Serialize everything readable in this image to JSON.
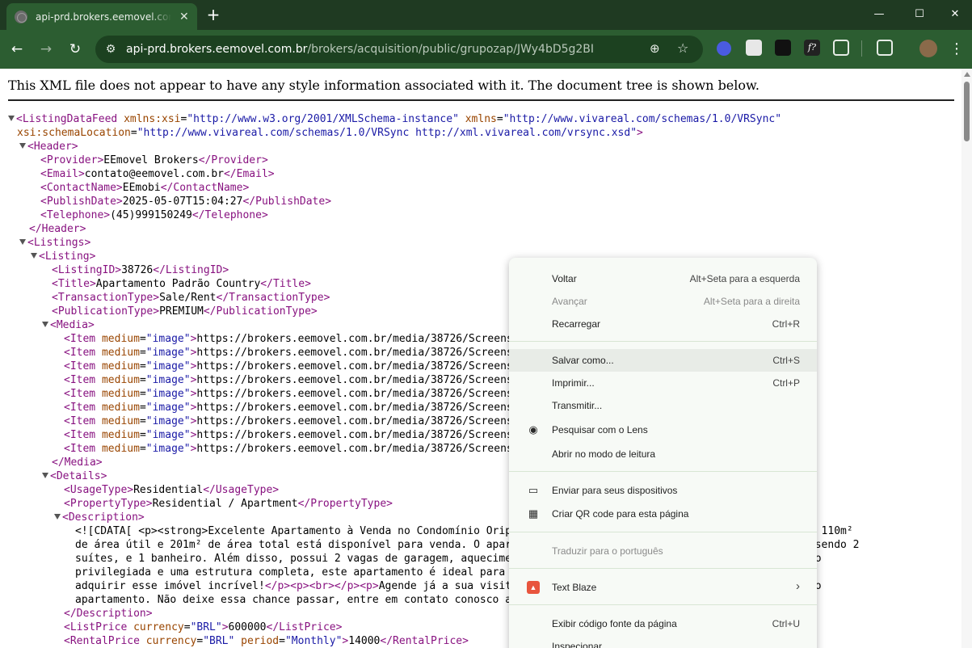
{
  "browser": {
    "tab_title": "api-prd.brokers.eemovel.com.br/brokers/acquisition/public/grupozap/JWy4bD5g2BI",
    "tab_close": "✕",
    "new_tab": "+",
    "window_minimize": "—",
    "window_maximize": "☐",
    "window_close": "✕",
    "url_host": "api-prd.brokers.eemovel.com.br",
    "url_path": "/brokers/acquisition/public/grupozap/JWy4bD5g2BI",
    "back": "←",
    "forward": "→",
    "reload": "↻",
    "site_info": "⚙",
    "zoom": "⊕",
    "bookmark": "☆",
    "menu": "⋮",
    "extension_f_label": "f?",
    "colors": {
      "tabbar": "#1f3a22",
      "toolbar": "#2c5d31",
      "omnibox": "#1c4120"
    }
  },
  "page": {
    "banner": "This XML file does not appear to have any style information associated with it. The document tree is shown below.",
    "xml_lines": [
      "<ListingDataFeed xmlns:xsi=\"http://www.w3.org/2001/XMLSchema-instance\" xmlns=\"http://www.vivareal.com/schemas/1.0/VRSync\"",
      "xsi:schemaLocation=\"http://www.vivareal.com/schemas/1.0/VRSync http://xml.vivareal.com/vrsync.xsd\">",
      "<Header>",
      "<Provider>EEmovel Brokers</Provider>",
      "<Email>contato@eemovel.com.br</Email>",
      "<ContactName>EEmobi</ContactName>",
      "<PublishDate>2025-05-07T15:04:27</PublishDate>",
      "<Telephone>(45)999150249</Telephone>",
      "</Header>",
      "<Listings>",
      "<Listing>",
      "<ListingID>38726</ListingID>",
      "<Title>Apartamento Padrão Country</Title>",
      "<TransactionType>Sale/Rent</TransactionType>",
      "<PublicationType>PREMIUM</PublicationType>",
      "<Media>",
      "<Item medium=\"image\">https://brokers.eemovel.com.br/media/38726/Screens",
      "<Item medium=\"image\">https://brokers.eemovel.com.br/media/38726/Screens",
      "<Item medium=\"image\">https://brokers.eemovel.com.br/media/38726/Screens",
      "<Item medium=\"image\">https://brokers.eemovel.com.br/media/38726/Screens",
      "<Item medium=\"image\">https://brokers.eemovel.com.br/media/38726/Screens",
      "<Item medium=\"image\">https://brokers.eemovel.com.br/media/38726/Screens",
      "<Item medium=\"image\">https://brokers.eemovel.com.br/media/38726/Screens",
      "<Item medium=\"image\">https://brokers.eemovel.com.br/media/38726/Screens",
      "<Item medium=\"image\">https://brokers.eemovel.com.br/media/38726/Screens",
      "</Media>",
      "<Details>",
      "<UsageType>Residential</UsageType>",
      "<PropertyType>Residential / Apartment</PropertyType>",
      "<Description>",
      "<![CDATA[ <p><strong>Excelente Apartamento à Venda no Condomínio Orip                                  este imóvel de 110m²",
      "de área útil e 201m² de área total está disponível para venda. O apar                                  om 3 quartos, sendo 2",
      "suítes, e 1 banheiro. Além disso, possui 2 vagas de garagem, aquecime                                  uma localização",
      "privilegiada e uma estrutura completa, este apartamento é ideal para                                  portunidade de",
      "adquirir esse imóvel incrível!</p><p><br></p><p>Agende já a sua visit                                  ste maravilhoso",
      "apartamento. Não deixe essa chance passar, entre em contato conosco a",
      "</Description>",
      "<ListPrice currency=\"BRL\">600000</ListPrice>",
      "<RentalPrice currency=\"BRL\" period=\"Monthly\">14000</RentalPrice>"
    ]
  },
  "context_menu": {
    "items": [
      {
        "label": "Voltar",
        "shortcut": "Alt+Seta para a esquerda"
      },
      {
        "label": "Avançar",
        "shortcut": "Alt+Seta para a direita"
      },
      {
        "label": "Recarregar",
        "shortcut": "Ctrl+R"
      },
      {
        "label": "Salvar como...",
        "shortcut": "Ctrl+S"
      },
      {
        "label": "Imprimir...",
        "shortcut": "Ctrl+P"
      },
      {
        "label": "Transmitir...",
        "shortcut": ""
      },
      {
        "label": "Pesquisar com o Lens",
        "shortcut": ""
      },
      {
        "label": "Abrir no modo de leitura",
        "shortcut": ""
      },
      {
        "label": "Enviar para seus dispositivos",
        "shortcut": ""
      },
      {
        "label": "Criar QR code para esta página",
        "shortcut": ""
      },
      {
        "label": "Traduzir para o português",
        "shortcut": ""
      },
      {
        "label": "Text Blaze",
        "shortcut": "›"
      },
      {
        "label": "Exibir código fonte da página",
        "shortcut": "Ctrl+U"
      },
      {
        "label": "Inspecionar",
        "shortcut": ""
      }
    ],
    "icons": {
      "lens": "◉",
      "devices": "▭",
      "qr": "▦",
      "blaze": "▲"
    }
  }
}
